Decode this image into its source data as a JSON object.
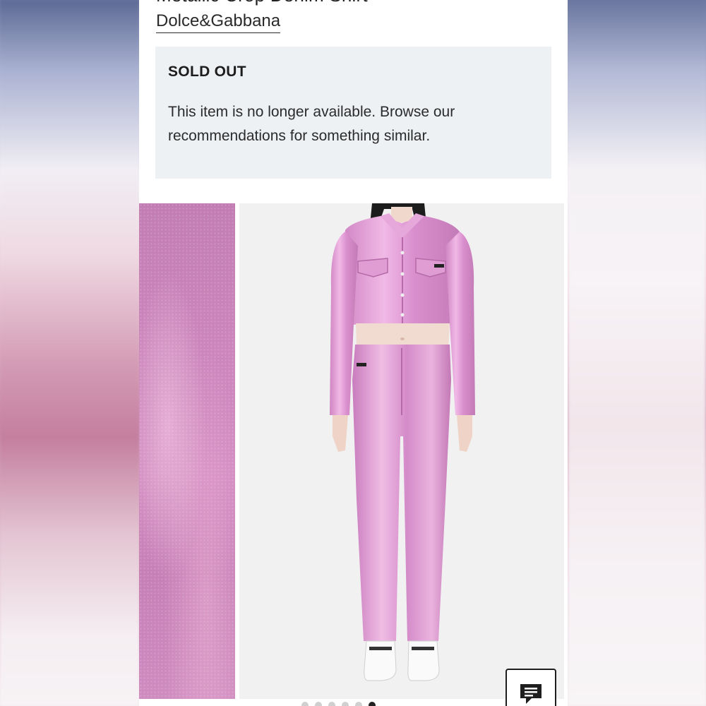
{
  "product": {
    "title_partial": "Metallic Crop Denim Shirt",
    "brand": "Dolce&Gabbana"
  },
  "availability": {
    "status": "SOLD OUT",
    "message": "This item is no longer available. Browse our recommendations for something similar."
  },
  "gallery": {
    "thumbnail_alt": "pink metallic fabric detail",
    "main_alt": "model wearing pink metallic crop shirt and jeans",
    "image_count": 6,
    "active_index": 5
  },
  "chat": {
    "icon": "chat-icon"
  },
  "colors": {
    "fabric_pink": "#d99bd0",
    "notice_bg": "#eef1f4"
  }
}
